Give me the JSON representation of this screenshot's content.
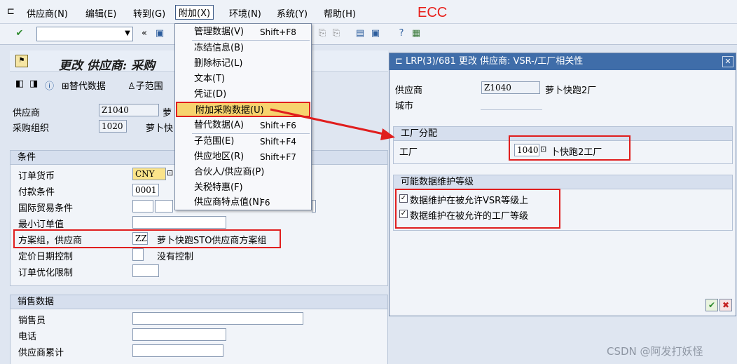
{
  "menu": {
    "items": [
      "供应商(N)",
      "编辑(E)",
      "转到(G)",
      "附加(X)",
      "环境(N)",
      "系统(Y)",
      "帮助(H)"
    ],
    "annotation": "ECC"
  },
  "toolbar": {
    "command_value": "",
    "back_glyph": "«"
  },
  "main": {
    "title": "更改 供应商: 采购",
    "subtoolbar": [
      "替代数据",
      "子范围"
    ],
    "vendor_label": "供应商",
    "vendor_value": "Z1040",
    "vendor_name": "萝",
    "purch_org_label": "采购组织",
    "purch_org_value": "1020",
    "purch_org_name": "萝卜快",
    "conditions": {
      "header": "条件",
      "currency_label": "订单货币",
      "currency_value": "CNY",
      "payment_label": "付款条件",
      "payment_value": "0001",
      "incoterms_label": "国际贸易条件",
      "min_order_label": "最小订单值",
      "schema_label": "方案组，供应商",
      "schema_value": "ZZ",
      "schema_desc": "萝卜快跑STO供应商方案组",
      "pricing_label": "定价日期控制",
      "pricing_desc": "没有控制",
      "optim_label": "订单优化限制"
    },
    "sales": {
      "header": "销售数据",
      "salesperson_label": "销售员",
      "phone_label": "电话",
      "vendor_acc_label": "供应商累计"
    }
  },
  "dropdown": {
    "items": [
      {
        "label": "管理数据(V)",
        "shortcut": "Shift+F8"
      },
      {
        "label": "冻结信息(B)",
        "shortcut": ""
      },
      {
        "label": "删除标记(L)",
        "shortcut": ""
      },
      {
        "label": "文本(T)",
        "shortcut": ""
      },
      {
        "label": "凭证(D)",
        "shortcut": ""
      },
      {
        "label": "附加采购数据(U)",
        "shortcut": ""
      },
      {
        "label": "替代数据(A)",
        "shortcut": "Shift+F6"
      },
      {
        "label": "子范围(E)",
        "shortcut": "Shift+F4"
      },
      {
        "label": "供应地区(R)",
        "shortcut": "Shift+F7"
      },
      {
        "label": "合伙人/供应商(P)",
        "shortcut": ""
      },
      {
        "label": "关税特惠(F)",
        "shortcut": ""
      },
      {
        "label": "供应商特点值(N)",
        "shortcut": "F6"
      }
    ]
  },
  "dialog": {
    "title": "LRP(3)/681 更改 供应商: VSR-/工厂相关性",
    "vendor_label": "供应商",
    "vendor_value": "Z1040",
    "vendor_name": "萝卜快跑2厂",
    "city_label": "城市",
    "plant_group": "工厂分配",
    "plant_label": "工厂",
    "plant_value": "1040",
    "plant_name": "卜快跑2工厂",
    "maint_group": "可能数据维护等级",
    "check1": "数据维护在被允许VSR等级上",
    "check2": "数据维护在被允许的工厂等级"
  },
  "watermark": "CSDN @阿发打妖怪"
}
